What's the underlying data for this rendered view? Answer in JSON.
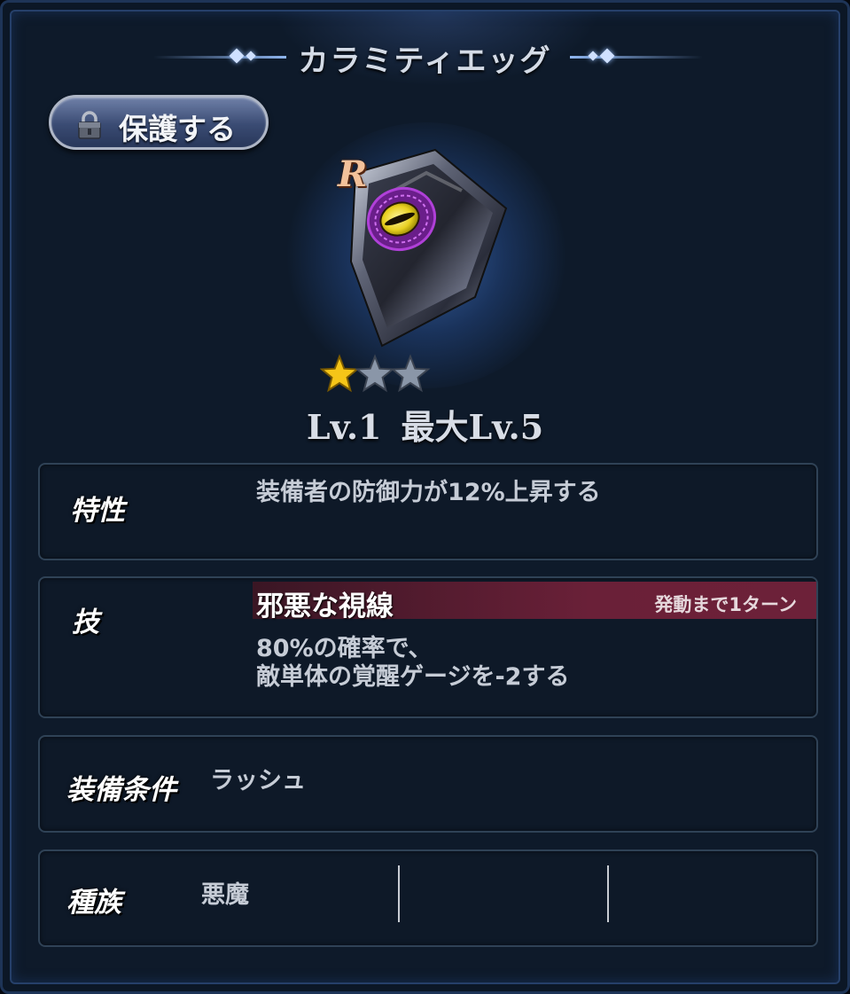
{
  "header": {
    "title": "カラミティエッグ"
  },
  "protect_button": {
    "label": "保護する",
    "icon": "lock-icon"
  },
  "item": {
    "rarity": "R",
    "image_icon": "shield-with-eye-icon",
    "stars_filled": 1,
    "stars_total": 3,
    "level_text": "Lv.1",
    "max_level_text": "最大Lv.5"
  },
  "trait": {
    "label": "特性",
    "text": "装備者の防御力が12%上昇する"
  },
  "skill": {
    "label": "技",
    "name": "邪悪な視線",
    "trigger": "発動まで1ターン",
    "description_line1": "80%の確率で、",
    "description_line2": "敵単体の覚醒ゲージを-2する"
  },
  "equip_condition": {
    "label": "装備条件",
    "value": "ラッシュ"
  },
  "race": {
    "label": "種族",
    "value": "悪魔"
  },
  "colors": {
    "background": "#0e1a2a",
    "skill_header": "#6a2038",
    "rarity": "#f3c19a",
    "star_gold": "#f5c518",
    "star_empty": "#8a96a8"
  }
}
